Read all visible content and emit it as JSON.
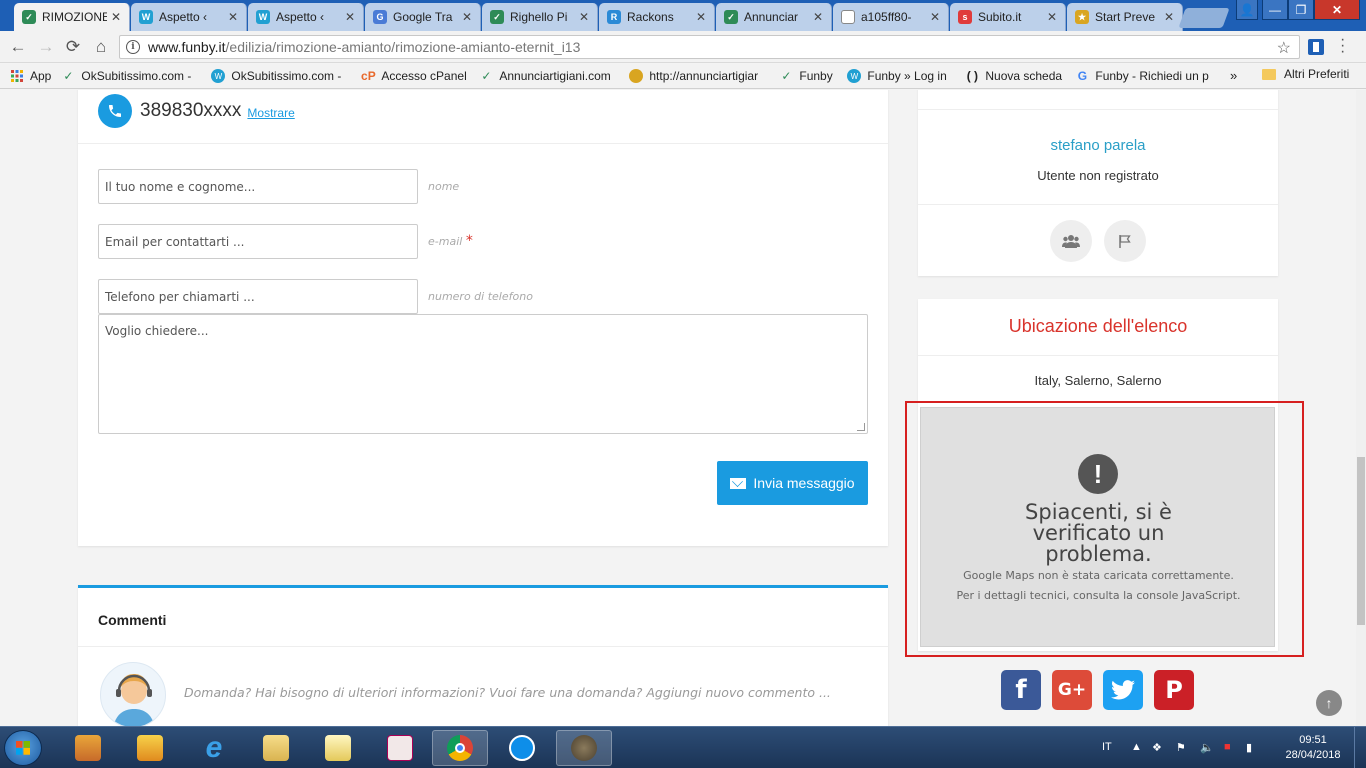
{
  "browser": {
    "tabs": [
      {
        "label": "RIMOZIONE",
        "favicon": "check-icon",
        "color": "#2e8b57",
        "active": true
      },
      {
        "label": "Aspetto ‹",
        "favicon": "wp-icon",
        "color": "#21a0d2",
        "active": false
      },
      {
        "label": "Aspetto ‹",
        "favicon": "wp-icon",
        "color": "#21a0d2",
        "active": false
      },
      {
        "label": "Google Tra",
        "favicon": "google-translate-icon",
        "color": "#4a7bd6",
        "active": false
      },
      {
        "label": "Righello Pi",
        "favicon": "check-icon",
        "color": "#2e8b57",
        "active": false
      },
      {
        "label": "Rackons",
        "favicon": "r-icon",
        "color": "#2b8ad6",
        "active": false
      },
      {
        "label": "Annunciar",
        "favicon": "check-icon",
        "color": "#2e8b57",
        "active": false
      },
      {
        "label": "a105ff80-",
        "favicon": "file-icon",
        "color": "#888888",
        "active": false
      },
      {
        "label": "Subito.it",
        "favicon": "subito-icon",
        "color": "#e03b3b",
        "active": false
      },
      {
        "label": "Start Preve",
        "favicon": "star-badge-icon",
        "color": "#d9a521",
        "active": false
      }
    ],
    "url_host": "www.funby.it",
    "url_path": "/edilizia/rimozione-amianto/rimozione-amianto-eternit_i13",
    "bookmarks": [
      {
        "label": "App",
        "icon": "apps-grid-icon"
      },
      {
        "label": "OkSubitissimo.com -",
        "icon": "check-icon"
      },
      {
        "label": "OkSubitissimo.com -",
        "icon": "wp-icon"
      },
      {
        "label": "Accesso cPanel",
        "icon": "cpanel-icon"
      },
      {
        "label": "Annunciartigiani.com",
        "icon": "check-icon"
      },
      {
        "label": "http://annunciartigiar",
        "icon": "avatar-icon"
      },
      {
        "label": "Funby",
        "icon": "check-icon"
      },
      {
        "label": "Funby » Log in",
        "icon": "wp-icon"
      },
      {
        "label": "Nuova scheda",
        "icon": "brackets-icon"
      },
      {
        "label": "Funby - Richiedi un p",
        "icon": "google-icon"
      }
    ],
    "bookmarks_more": "»",
    "bookmarks_other": "Altri Preferiti"
  },
  "contact": {
    "phone": "389830xxxx",
    "show_link": "Mostrare",
    "name_placeholder": "Il tuo nome e cognome...",
    "name_hint": "nome",
    "email_placeholder": "Email per contattarti ...",
    "email_hint": "e-mail",
    "email_required": "*",
    "phone_placeholder": "Telefono per chiamarti ...",
    "phone_hint": "numero di telefono",
    "message_placeholder": "Voglio chiedere...",
    "send_label": "Invia messaggio"
  },
  "comments": {
    "title": "Commenti",
    "prompt": "Domanda? Hai bisogno di ulteriori informazioni? Vuoi fare una domanda? Aggiungi nuovo commento ..."
  },
  "user": {
    "name": "stefano parela",
    "status": "Utente non registrato"
  },
  "location": {
    "title": "Ubicazione dell'elenco",
    "text": "Italy, Salerno, Salerno",
    "map_error_title": "Spiacenti, si è verificato un problema.",
    "map_error_line1": "Google Maps non è stata caricata correttamente.",
    "map_error_line2": "Per i dettagli tecnici, consulta la console JavaScript."
  },
  "social": [
    {
      "name": "facebook-icon",
      "glyph": "f",
      "color": "#3b5998"
    },
    {
      "name": "google-plus-icon",
      "glyph": "G+",
      "color": "#dd4b39"
    },
    {
      "name": "twitter-icon",
      "glyph": "t",
      "color": "#1da1f2"
    },
    {
      "name": "pinterest-icon",
      "glyph": "P",
      "color": "#cb2027"
    }
  ],
  "taskbar": {
    "lang": "IT",
    "time": "09:51",
    "date": "28/04/2018"
  }
}
